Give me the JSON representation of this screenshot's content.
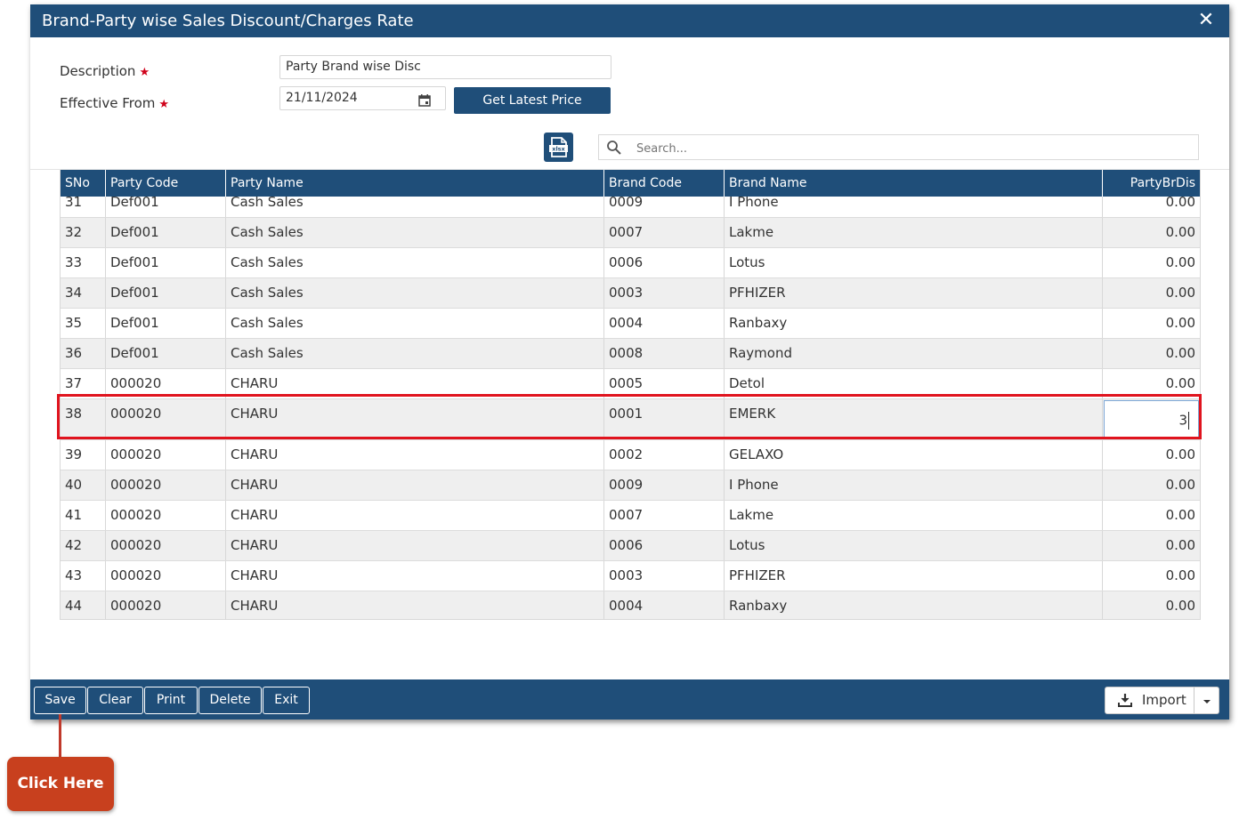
{
  "window": {
    "title": "Brand-Party wise Sales Discount/Charges Rate",
    "close_glyph": "✕"
  },
  "form": {
    "description_label": "Description",
    "description_value": "Party Brand wise Disc",
    "effective_from_label": "Effective From",
    "effective_from_value": "21/11/2024",
    "required_mark": "★",
    "get_latest_price_label": "Get Latest Price"
  },
  "toolbar": {
    "xlsx_label": "xlsx",
    "search_placeholder": "Search..."
  },
  "table": {
    "columns": [
      "SNo",
      "Party Code",
      "Party Name",
      "Brand Code",
      "Brand Name",
      "PartyBrDis"
    ],
    "rows": [
      {
        "sno": "31",
        "party_code": "Def001",
        "party_name": "Cash Sales",
        "brand_code": "0009",
        "brand_name": "I Phone",
        "party_br_dis": "0.00"
      },
      {
        "sno": "32",
        "party_code": "Def001",
        "party_name": "Cash Sales",
        "brand_code": "0007",
        "brand_name": "Lakme",
        "party_br_dis": "0.00"
      },
      {
        "sno": "33",
        "party_code": "Def001",
        "party_name": "Cash Sales",
        "brand_code": "0006",
        "brand_name": "Lotus",
        "party_br_dis": "0.00"
      },
      {
        "sno": "34",
        "party_code": "Def001",
        "party_name": "Cash Sales",
        "brand_code": "0003",
        "brand_name": "PFHIZER",
        "party_br_dis": "0.00"
      },
      {
        "sno": "35",
        "party_code": "Def001",
        "party_name": "Cash Sales",
        "brand_code": "0004",
        "brand_name": "Ranbaxy",
        "party_br_dis": "0.00"
      },
      {
        "sno": "36",
        "party_code": "Def001",
        "party_name": "Cash Sales",
        "brand_code": "0008",
        "brand_name": "Raymond",
        "party_br_dis": "0.00"
      },
      {
        "sno": "37",
        "party_code": "000020",
        "party_name": "CHARU",
        "brand_code": "0005",
        "brand_name": "Detol",
        "party_br_dis": "0.00"
      },
      {
        "sno": "38",
        "party_code": "000020",
        "party_name": "CHARU",
        "brand_code": "0001",
        "brand_name": "EMERK",
        "party_br_dis": "3",
        "editing": true
      },
      {
        "sno": "39",
        "party_code": "000020",
        "party_name": "CHARU",
        "brand_code": "0002",
        "brand_name": "GELAXO",
        "party_br_dis": "0.00"
      },
      {
        "sno": "40",
        "party_code": "000020",
        "party_name": "CHARU",
        "brand_code": "0009",
        "brand_name": "I Phone",
        "party_br_dis": "0.00"
      },
      {
        "sno": "41",
        "party_code": "000020",
        "party_name": "CHARU",
        "brand_code": "0007",
        "brand_name": "Lakme",
        "party_br_dis": "0.00"
      },
      {
        "sno": "42",
        "party_code": "000020",
        "party_name": "CHARU",
        "brand_code": "0006",
        "brand_name": "Lotus",
        "party_br_dis": "0.00"
      },
      {
        "sno": "43",
        "party_code": "000020",
        "party_name": "CHARU",
        "brand_code": "0003",
        "brand_name": "PFHIZER",
        "party_br_dis": "0.00"
      },
      {
        "sno": "44",
        "party_code": "000020",
        "party_name": "CHARU",
        "brand_code": "0004",
        "brand_name": "Ranbaxy",
        "party_br_dis": "0.00"
      }
    ]
  },
  "footer": {
    "save_label": "Save",
    "clear_label": "Clear",
    "print_label": "Print",
    "delete_label": "Delete",
    "exit_label": "Exit",
    "import_label": "Import"
  },
  "annotation": {
    "callout_text": "Click Here"
  },
  "colors": {
    "primary": "#1f4e79",
    "highlight": "#e0141e",
    "callout": "#c8401e"
  }
}
